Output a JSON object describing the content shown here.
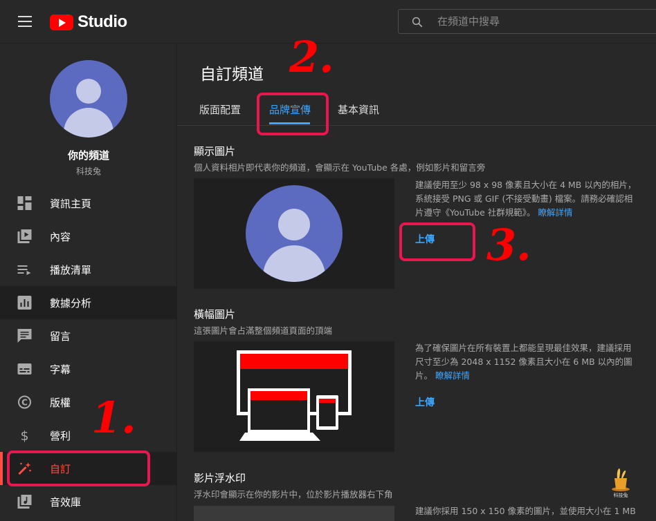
{
  "header": {
    "logo_text": "Studio",
    "search_placeholder": "在頻道中搜尋"
  },
  "sidebar": {
    "channel_name": "你的頻道",
    "channel_handle": "科技兔",
    "items": [
      {
        "label": "資訊主頁",
        "icon": "dashboard-icon"
      },
      {
        "label": "內容",
        "icon": "content-icon"
      },
      {
        "label": "播放清單",
        "icon": "playlist-icon"
      },
      {
        "label": "數據分析",
        "icon": "analytics-icon"
      },
      {
        "label": "留言",
        "icon": "comments-icon"
      },
      {
        "label": "字幕",
        "icon": "subtitles-icon"
      },
      {
        "label": "版權",
        "icon": "copyright-icon"
      },
      {
        "label": "營利",
        "icon": "dollar-icon"
      },
      {
        "label": "自訂",
        "icon": "magic-wand-icon"
      },
      {
        "label": "音效庫",
        "icon": "audio-library-icon"
      }
    ]
  },
  "main": {
    "title": "自訂頻道",
    "tabs": [
      {
        "label": "版面配置"
      },
      {
        "label": "品牌宣傳"
      },
      {
        "label": "基本資訊"
      }
    ],
    "active_tab": "品牌宣傳",
    "sections": {
      "picture": {
        "title": "顯示圖片",
        "subtitle": "個人資料相片即代表你的頻道，會顯示在 YouTube 各處，例如影片和留言旁",
        "desc_line1": "建議使用至少 98 x 98 像素且大小在 4 MB 以內的相片，",
        "desc_line2": "系統接受 PNG 或 GIF (不接受動畫) 檔案。請務必確認相",
        "desc_line3": "片遵守《YouTube 社群規範》。",
        "learn_more": "瞭解詳情",
        "upload": "上傳"
      },
      "banner": {
        "title": "橫幅圖片",
        "subtitle": "這張圖片會占滿整個頻道頁面的頂端",
        "desc_line1": "為了確保圖片在所有裝置上都能呈現最佳效果，建議採用",
        "desc_line2": "尺寸至少為 2048 x 1152 像素且大小在 6 MB 以內的圖",
        "desc_line3": "片。",
        "learn_more": "瞭解詳情",
        "upload": "上傳"
      },
      "watermark": {
        "title": "影片浮水印",
        "subtitle": "浮水印會顯示在你的影片中，位於影片播放器右下角",
        "desc_line1": "建議你採用 150 x 150 像素的圖片，並使用大小在 1 MB"
      }
    }
  },
  "annotations": {
    "step1": "1.",
    "step2": "2.",
    "step3": "3.",
    "color": "#e8174d"
  },
  "watermark_logo": {
    "text": "科技兔"
  },
  "colors": {
    "brand_red": "#ff0000",
    "accent_blue": "#3ea6ff",
    "active_red": "#ff4e45",
    "avatar_blue": "#5c6bc0"
  }
}
